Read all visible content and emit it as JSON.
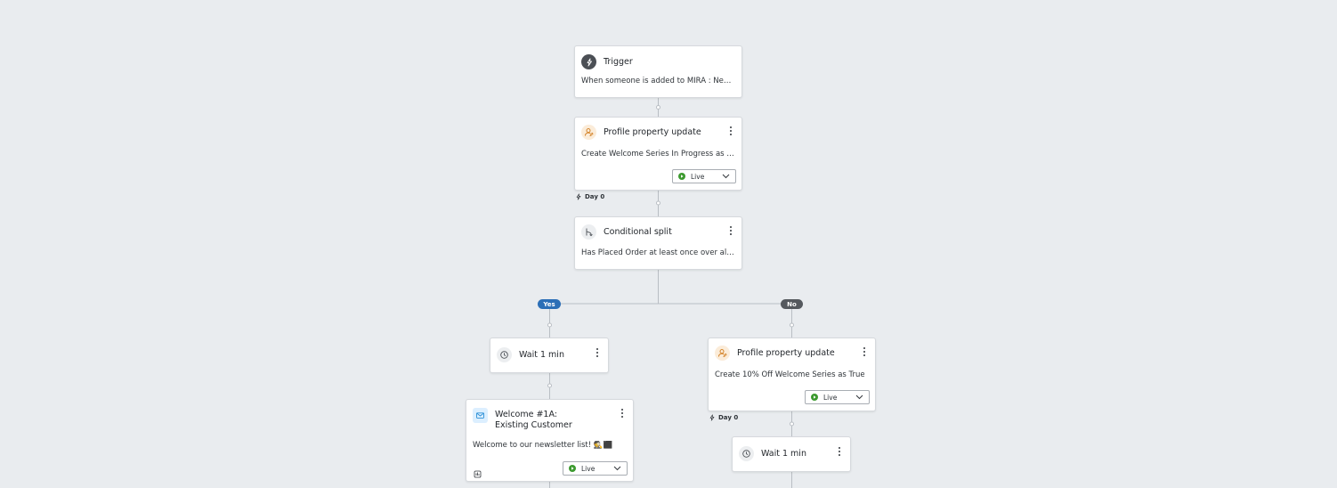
{
  "flow": {
    "trigger": {
      "title": "Trigger",
      "description": "When someone is added to MIRA : Newsle..."
    },
    "profile_update_1": {
      "title": "Profile property update",
      "description": "Create Welcome Series In Progress as True",
      "status": "Live",
      "day": "Day 0"
    },
    "conditional_split": {
      "title": "Conditional split",
      "description": "Has Placed Order at least once over all time."
    },
    "branch_yes": {
      "label": "Yes",
      "color": "#2c6fb7"
    },
    "branch_no": {
      "label": "No",
      "color": "#55595e"
    },
    "yes_wait": {
      "title": "Wait 1 min"
    },
    "yes_email": {
      "title": "Welcome #1A: Existing Customer",
      "description": "Welcome to our newsletter list! 🕵️⬛",
      "status": "Live"
    },
    "no_profile_update": {
      "title": "Profile property update",
      "description": "Create 10% Off Welcome Series as True",
      "status": "Live",
      "day": "Day 0"
    },
    "no_wait": {
      "title": "Wait 1 min"
    }
  },
  "colors": {
    "canvas_bg": "#e9ecef",
    "live_green": "#3c9a2f",
    "connector": "#b9bec4"
  }
}
